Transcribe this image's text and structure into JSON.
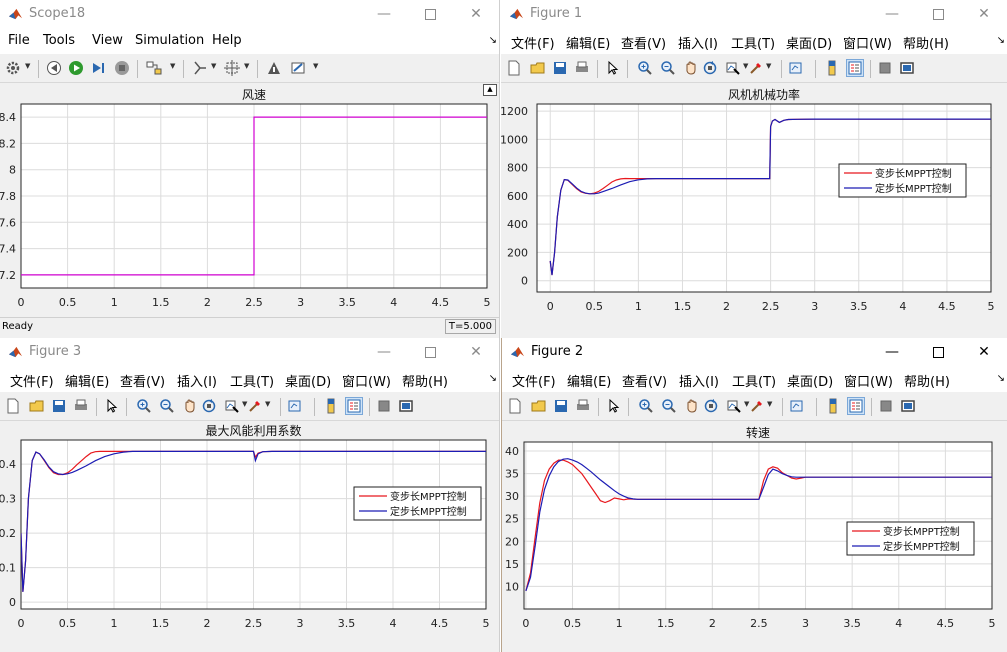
{
  "colors": {
    "red": "#e8181e",
    "blue": "#1c1cb4",
    "magenta": "#d100d1",
    "plot_bg": "#ffffff",
    "grid": "#dcdcdc"
  },
  "scope": {
    "title": "Scope18",
    "menus": [
      "File",
      "Tools",
      "View",
      "Simulation",
      "Help"
    ],
    "toolbar_icons": [
      "gear-icon",
      "step-back-icon",
      "run-icon",
      "step-forward-icon",
      "stop-icon",
      "highlight-icon",
      "cursor-measure-icon",
      "autoscale-icon",
      "write-data-icon",
      "style-icon"
    ],
    "status": "Ready",
    "time": "T=5.000"
  },
  "fig1": {
    "title": "Figure 1",
    "menus": [
      "文件(F)",
      "编辑(E)",
      "查看(V)",
      "插入(I)",
      "工具(T)",
      "桌面(D)",
      "窗口(W)",
      "帮助(H)"
    ]
  },
  "fig3": {
    "title": "Figure 3",
    "menus": [
      "文件(F)",
      "编辑(E)",
      "查看(V)",
      "插入(I)",
      "工具(T)",
      "桌面(D)",
      "窗口(W)",
      "帮助(H)"
    ]
  },
  "fig2": {
    "title": "Figure 2",
    "menus": [
      "文件(F)",
      "编辑(E)",
      "查看(V)",
      "插入(I)",
      "工具(T)",
      "桌面(D)",
      "窗口(W)",
      "帮助(H)"
    ]
  },
  "figure_toolbar_icons": [
    "new-figure-icon",
    "open-icon",
    "save-icon",
    "print-icon",
    "pointer-icon",
    "zoom-in-icon",
    "zoom-out-icon",
    "pan-icon",
    "rotate-icon",
    "data-cursor-icon",
    "brush-icon",
    "link-plot-icon",
    "colorbar-icon",
    "legend-icon",
    "hide-plot-tools-icon",
    "show-plot-tools-icon"
  ],
  "chart_data": [
    {
      "id": "scope",
      "type": "line",
      "title": "风速",
      "xlabel": "",
      "ylabel": "",
      "xlim": [
        0,
        5
      ],
      "ylim": [
        7.1,
        8.5
      ],
      "xticks": [
        0,
        0.5,
        1,
        1.5,
        2,
        2.5,
        3,
        3.5,
        4,
        4.5,
        5
      ],
      "yticks": [
        7.2,
        7.4,
        7.6,
        7.8,
        8,
        8.2,
        8.4
      ],
      "grid": true,
      "legend": "none",
      "series": [
        {
          "color": "#d100d1",
          "x": [
            0,
            2.5,
            2.5,
            5
          ],
          "y": [
            7.2,
            7.2,
            8.4,
            8.4
          ]
        }
      ]
    },
    {
      "id": "fig1",
      "type": "line",
      "title": "风机机械功率",
      "xlabel": "",
      "ylabel": "",
      "xlim": [
        -0.15,
        5
      ],
      "ylim": [
        -80,
        1250
      ],
      "xticks": [
        0,
        0.5,
        1,
        1.5,
        2,
        2.5,
        3,
        3.5,
        4,
        4.5,
        5
      ],
      "yticks": [
        0,
        200,
        400,
        600,
        800,
        1000,
        1200
      ],
      "grid": true,
      "legend": "right",
      "series": [
        {
          "name": "变步长MPPT控制",
          "color": "#e8181e",
          "x": [
            0,
            0.02,
            0.05,
            0.08,
            0.12,
            0.16,
            0.2,
            0.25,
            0.3,
            0.35,
            0.4,
            0.45,
            0.5,
            0.55,
            0.6,
            0.65,
            0.7,
            0.75,
            0.8,
            0.85,
            0.9,
            1.0,
            1.2,
            1.5,
            2.0,
            2.49,
            2.5,
            2.52,
            2.55,
            2.6,
            2.65,
            2.7,
            2.8,
            3.0,
            3.5,
            4.0,
            4.5,
            5.0
          ],
          "y": [
            140,
            40,
            200,
            450,
            640,
            715,
            710,
            680,
            650,
            628,
            618,
            615,
            620,
            632,
            652,
            675,
            698,
            712,
            720,
            723,
            722,
            722,
            722,
            722,
            722,
            722,
            1090,
            1130,
            1140,
            1120,
            1135,
            1140,
            1142,
            1143,
            1143,
            1143,
            1143,
            1143
          ]
        },
        {
          "name": "定步长MPPT控制",
          "color": "#1c1cb4",
          "x": [
            0,
            0.02,
            0.05,
            0.08,
            0.12,
            0.16,
            0.2,
            0.25,
            0.3,
            0.35,
            0.4,
            0.45,
            0.5,
            0.55,
            0.6,
            0.7,
            0.8,
            0.9,
            1.0,
            1.1,
            1.2,
            1.5,
            2.0,
            2.49,
            2.5,
            2.52,
            2.55,
            2.6,
            2.65,
            2.7,
            2.8,
            3.0,
            3.5,
            4.0,
            4.5,
            5.0
          ],
          "y": [
            140,
            40,
            200,
            450,
            640,
            715,
            712,
            685,
            655,
            632,
            620,
            615,
            615,
            620,
            630,
            652,
            678,
            700,
            714,
            720,
            722,
            722,
            722,
            722,
            1090,
            1130,
            1140,
            1120,
            1135,
            1140,
            1142,
            1143,
            1143,
            1143,
            1143,
            1143
          ]
        }
      ]
    },
    {
      "id": "fig3",
      "type": "line",
      "title": "最大风能利用系数",
      "xlabel": "",
      "ylabel": "",
      "xlim": [
        0,
        5
      ],
      "ylim": [
        -0.02,
        0.47
      ],
      "xticks": [
        0,
        0.5,
        1,
        1.5,
        2,
        2.5,
        3,
        3.5,
        4,
        4.5,
        5
      ],
      "yticks": [
        0,
        0.1,
        0.2,
        0.3,
        0.4
      ],
      "grid": true,
      "legend": "right",
      "series": [
        {
          "name": "变步长MPPT控制",
          "color": "#e8181e",
          "x": [
            0,
            0.02,
            0.05,
            0.08,
            0.12,
            0.16,
            0.2,
            0.25,
            0.3,
            0.35,
            0.4,
            0.45,
            0.5,
            0.55,
            0.6,
            0.65,
            0.7,
            0.75,
            0.8,
            0.85,
            0.9,
            1.0,
            1.5,
            2.0,
            2.49,
            2.5,
            2.52,
            2.55,
            2.6,
            2.7,
            3.0,
            4.0,
            5.0
          ],
          "y": [
            0.2,
            0.03,
            0.12,
            0.3,
            0.41,
            0.435,
            0.43,
            0.41,
            0.39,
            0.375,
            0.37,
            0.37,
            0.375,
            0.385,
            0.398,
            0.41,
            0.422,
            0.432,
            0.436,
            0.437,
            0.437,
            0.437,
            0.437,
            0.437,
            0.437,
            0.437,
            0.42,
            0.432,
            0.436,
            0.437,
            0.437,
            0.437,
            0.437
          ]
        },
        {
          "name": "定步长MPPT控制",
          "color": "#1c1cb4",
          "x": [
            0,
            0.02,
            0.05,
            0.08,
            0.12,
            0.16,
            0.2,
            0.25,
            0.3,
            0.35,
            0.4,
            0.45,
            0.5,
            0.55,
            0.6,
            0.7,
            0.8,
            0.9,
            1.0,
            1.1,
            1.2,
            1.5,
            2.0,
            2.49,
            2.5,
            2.52,
            2.55,
            2.6,
            2.7,
            3.0,
            4.0,
            5.0
          ],
          "y": [
            0.2,
            0.03,
            0.12,
            0.3,
            0.41,
            0.435,
            0.43,
            0.412,
            0.392,
            0.378,
            0.372,
            0.37,
            0.372,
            0.376,
            0.382,
            0.395,
            0.41,
            0.422,
            0.43,
            0.435,
            0.437,
            0.437,
            0.437,
            0.437,
            0.437,
            0.41,
            0.43,
            0.436,
            0.437,
            0.437,
            0.437,
            0.437
          ]
        }
      ]
    },
    {
      "id": "fig2",
      "type": "line",
      "title": "转速",
      "xlabel": "",
      "ylabel": "",
      "xlim": [
        -0.02,
        5
      ],
      "ylim": [
        5,
        42
      ],
      "xticks": [
        0,
        0.5,
        1,
        1.5,
        2,
        2.5,
        3,
        3.5,
        4,
        4.5,
        5
      ],
      "yticks": [
        10,
        15,
        20,
        25,
        30,
        35,
        40
      ],
      "grid": true,
      "legend": "right",
      "series": [
        {
          "name": "变步长MPPT控制",
          "color": "#e8181e",
          "x": [
            0,
            0.05,
            0.1,
            0.15,
            0.2,
            0.25,
            0.3,
            0.35,
            0.4,
            0.45,
            0.5,
            0.55,
            0.6,
            0.65,
            0.7,
            0.75,
            0.8,
            0.85,
            0.9,
            0.95,
            1.0,
            1.05,
            1.1,
            1.2,
            1.5,
            2.0,
            2.5,
            2.55,
            2.6,
            2.65,
            2.7,
            2.75,
            2.8,
            2.85,
            2.9,
            2.95,
            3.0,
            3.5,
            4.0,
            4.5,
            5.0
          ],
          "y": [
            9,
            13,
            21,
            28.5,
            33.5,
            36,
            37.3,
            38,
            38,
            37.6,
            37,
            36,
            35,
            33.5,
            32,
            30.5,
            29,
            28.6,
            29,
            29.6,
            29.4,
            29.2,
            29.4,
            29.3,
            29.3,
            29.3,
            29.3,
            33.5,
            36,
            36.5,
            36.2,
            35.2,
            34.6,
            34.0,
            33.8,
            34.0,
            34.2,
            34.2,
            34.2,
            34.2,
            34.2
          ]
        },
        {
          "name": "定步长MPPT控制",
          "color": "#1c1cb4",
          "x": [
            0,
            0.05,
            0.1,
            0.15,
            0.2,
            0.25,
            0.3,
            0.35,
            0.4,
            0.45,
            0.5,
            0.55,
            0.6,
            0.65,
            0.7,
            0.75,
            0.8,
            0.85,
            0.9,
            0.95,
            1.0,
            1.05,
            1.1,
            1.15,
            1.2,
            1.5,
            2.0,
            2.5,
            2.55,
            2.6,
            2.65,
            2.7,
            2.75,
            2.8,
            2.85,
            2.9,
            3.0,
            3.5,
            4.0,
            4.5,
            5.0
          ],
          "y": [
            9,
            12,
            19,
            26.5,
            31.5,
            34.5,
            36.5,
            37.7,
            38.2,
            38.3,
            38,
            37.6,
            37,
            36.2,
            35.4,
            34.5,
            33.6,
            32.8,
            32,
            31.2,
            30.5,
            30,
            29.6,
            29.4,
            29.3,
            29.3,
            29.3,
            29.3,
            32,
            34.8,
            36,
            35.6,
            35,
            34.6,
            34.3,
            34.2,
            34.2,
            34.2,
            34.2,
            34.2,
            34.2
          ]
        }
      ]
    }
  ]
}
